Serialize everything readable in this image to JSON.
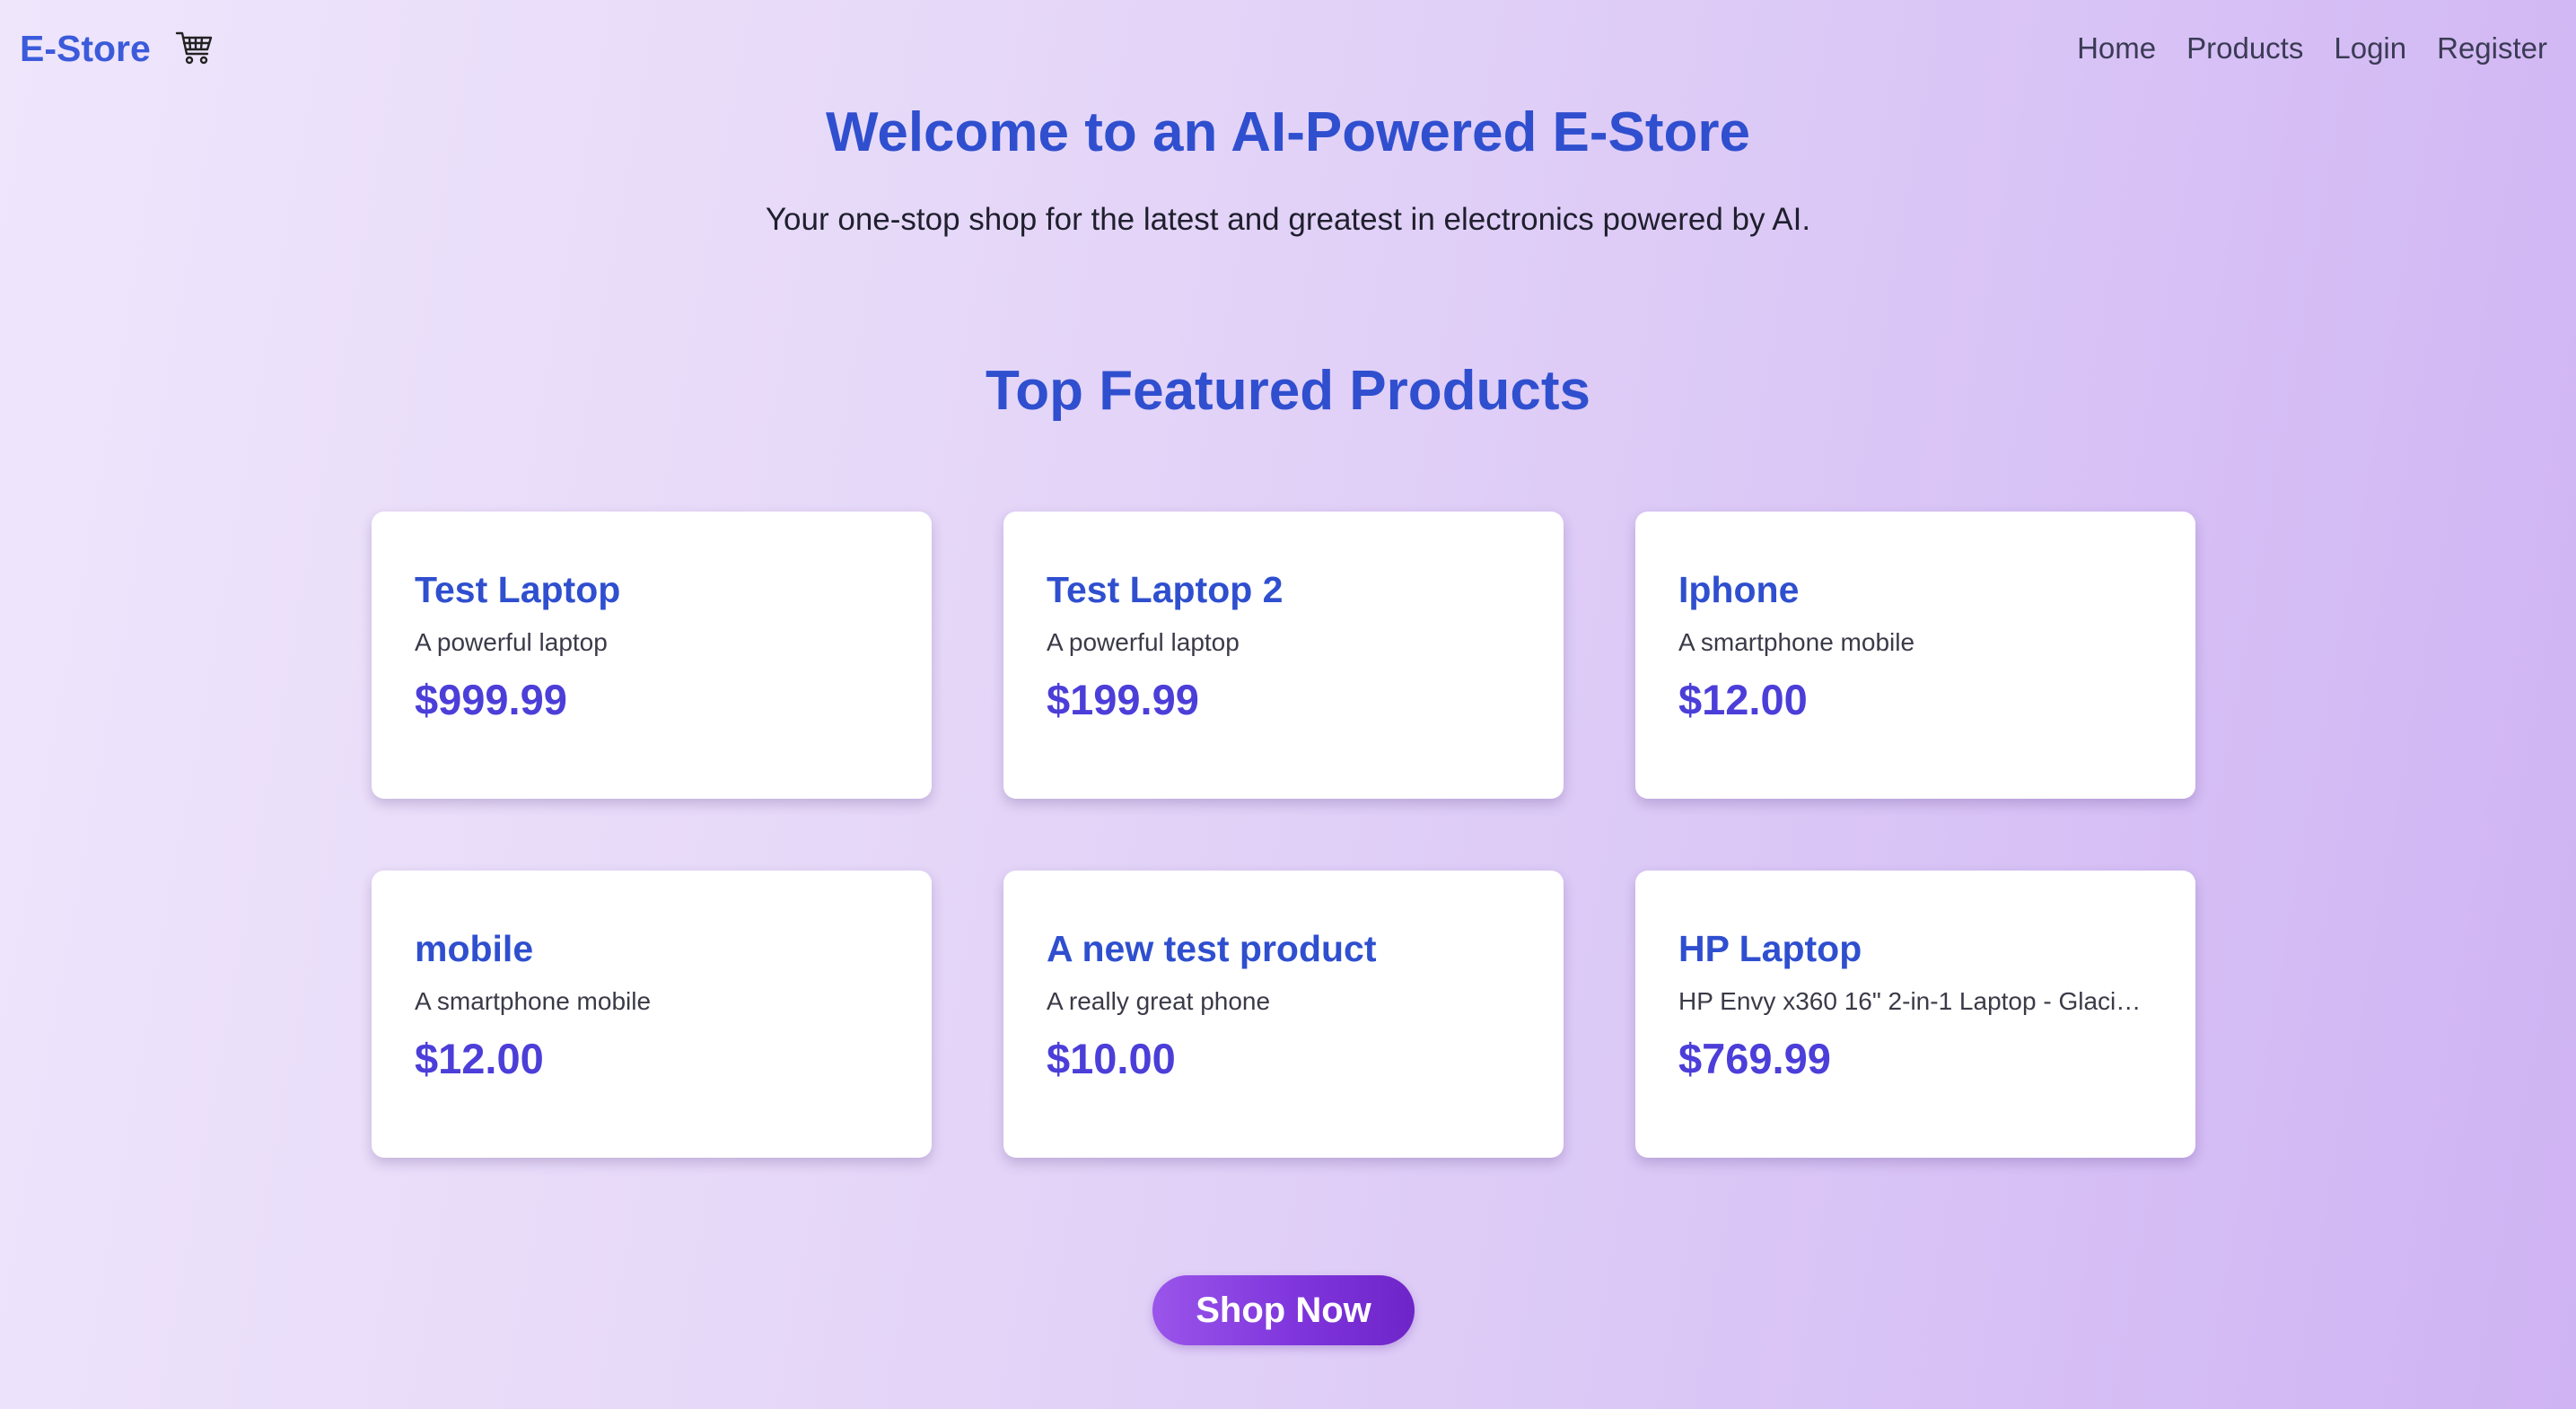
{
  "navbar": {
    "brand": "E-Store",
    "cart_icon": "shopping-cart-icon",
    "links": [
      "Home",
      "Products",
      "Login",
      "Register"
    ]
  },
  "hero": {
    "title": "Welcome to an AI-Powered E-Store",
    "subtitle": "Your one-stop shop for the latest and greatest in electronics powered by AI."
  },
  "featured": {
    "title": "Top Featured Products",
    "products": [
      {
        "name": "Test Laptop",
        "description": "A powerful laptop",
        "price": "$999.99"
      },
      {
        "name": "Test Laptop 2",
        "description": "A powerful laptop",
        "price": "$199.99"
      },
      {
        "name": "Iphone",
        "description": "A smartphone mobile",
        "price": "$12.00"
      },
      {
        "name": "mobile",
        "description": "A smartphone mobile",
        "price": "$12.00"
      },
      {
        "name": "A new test product",
        "description": "A really great phone",
        "price": "$10.00"
      },
      {
        "name": "HP Laptop",
        "description": "HP Envy x360 16\" 2-in-1 Laptop - Glaci…",
        "price": "$769.99"
      }
    ]
  },
  "cta": {
    "label": "Shop Now"
  },
  "colors": {
    "accent_blue": "#2f4fcf",
    "price_purple": "#4c3ed8",
    "button_purple": "#7f35dc",
    "background": "#e6d8f8"
  }
}
